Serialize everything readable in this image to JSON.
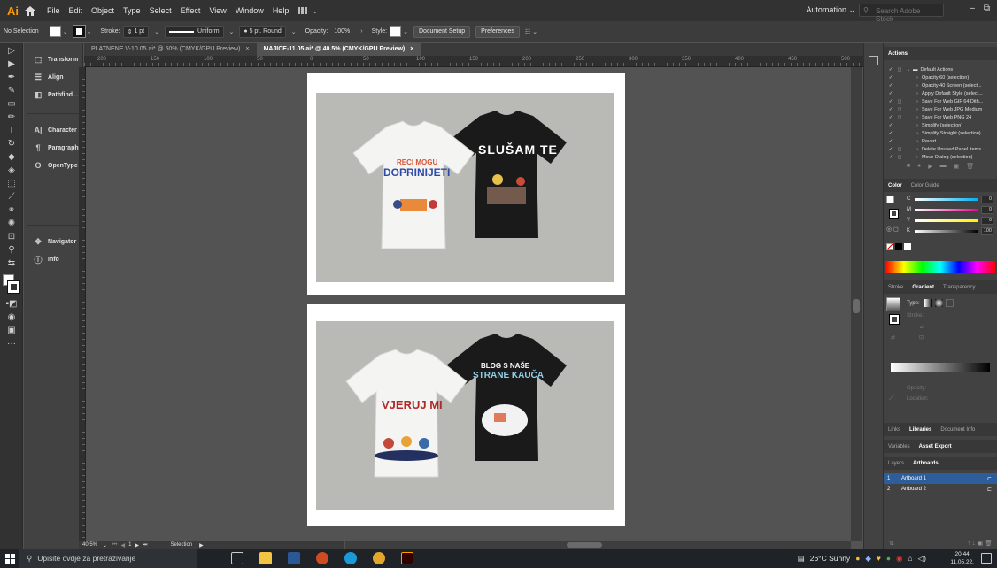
{
  "app": {
    "logo": "Ai"
  },
  "menu": [
    "File",
    "Edit",
    "Object",
    "Type",
    "Select",
    "Effect",
    "View",
    "Window",
    "Help"
  ],
  "workspace": "Automation ⌄",
  "stock_search_placeholder": "Search Adobe Stock",
  "control_bar": {
    "selection": "No Selection",
    "stroke_label": "Stroke:",
    "stroke_value": "1 pt",
    "profile": "Uniform",
    "brush": "5 pt. Round",
    "opacity_label": "Opacity:",
    "opacity_value": "100%",
    "style_label": "Style:",
    "document_setup": "Document Setup",
    "preferences": "Preferences"
  },
  "panel_strip": {
    "group1": [
      {
        "icon": "transform-icon",
        "label": "Transform"
      },
      {
        "icon": "align-icon",
        "label": "Align"
      },
      {
        "icon": "pathfinder-icon",
        "label": "Pathfind..."
      }
    ],
    "group2": [
      {
        "icon": "character-icon",
        "label": "Character"
      },
      {
        "icon": "paragraph-icon",
        "label": "Paragraph"
      },
      {
        "icon": "opentype-icon",
        "label": "OpenType"
      }
    ],
    "group3": [
      {
        "icon": "navigator-icon",
        "label": "Navigator"
      },
      {
        "icon": "info-icon",
        "label": "Info"
      }
    ]
  },
  "doc_tabs": [
    {
      "label": "PLATNENE V-10.05.ai* @ 50% (CMYK/GPU Preview)",
      "active": false
    },
    {
      "label": "MAJICE-11.05.ai* @ 40.5% (CMYK/GPU Preview)",
      "active": true
    }
  ],
  "ruler_ticks": [
    "200",
    "150",
    "100",
    "50",
    "0",
    "50",
    "100",
    "150",
    "200",
    "250",
    "300",
    "350",
    "400",
    "450",
    "500"
  ],
  "artwork": {
    "shirt1_lines": [
      "RECI MOGU",
      "DOPRINIJETI"
    ],
    "shirt2_lines": [
      "SLUŠAM TE"
    ],
    "shirt3_lines": [
      "VJERUJ MI"
    ],
    "shirt4_lines": [
      "BLOG S NAŠE",
      "STRANE KAUČA"
    ]
  },
  "status": {
    "zoom": "40.5%",
    "page": "1",
    "tool": "Selection"
  },
  "actions_panel": {
    "tab": "Actions",
    "rows": [
      {
        "label": "Default Actions",
        "type": "set"
      },
      {
        "label": "Opacity 60 (selection)"
      },
      {
        "label": "Opacity 40 Screen (select..."
      },
      {
        "label": "Apply Default Style (select..."
      },
      {
        "label": "Save For Web GIF 64 Dith..."
      },
      {
        "label": "Save For Web JPG Medium"
      },
      {
        "label": "Save For Web PNG 24"
      },
      {
        "label": "Simplify (selection)"
      },
      {
        "label": "Simplify Straight (selection)"
      },
      {
        "label": "Revert"
      },
      {
        "label": "Delete Unused Panel Items"
      },
      {
        "label": "Move Dialog (selection)"
      }
    ]
  },
  "color_panel": {
    "tabs": [
      "Color",
      "Color Guide"
    ],
    "channels": [
      {
        "label": "C",
        "value": "0"
      },
      {
        "label": "M",
        "value": "0"
      },
      {
        "label": "Y",
        "value": "0"
      },
      {
        "label": "K",
        "value": "100"
      }
    ]
  },
  "gradient_panel": {
    "tabs": [
      "Stroke",
      "Gradient",
      "Transparency"
    ],
    "type_label": "Type:",
    "stroke_label": "Stroke:",
    "opacity_label": "Opacity:",
    "location_label": "Location:"
  },
  "bottom_tabs1": [
    "Links",
    "Libraries",
    "Document Info"
  ],
  "bottom_tabs2": [
    "Variables",
    "Asset Export"
  ],
  "bottom_tabs3": [
    "Layers",
    "Artboards"
  ],
  "artboards": [
    {
      "num": "1",
      "name": "Artboard 1",
      "selected": true
    },
    {
      "num": "2",
      "name": "Artboard 2",
      "selected": false
    }
  ],
  "taskbar": {
    "search_placeholder": "Upišite ovdje za pretraživanje",
    "weather": "26°C  Sunny",
    "time": "20:44",
    "date": "11.05.22."
  }
}
